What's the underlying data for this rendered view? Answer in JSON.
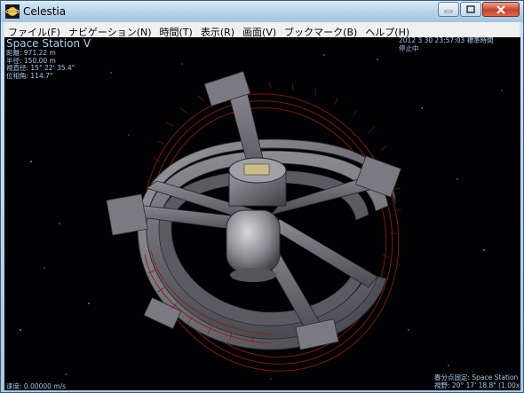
{
  "window": {
    "title": "Celestia"
  },
  "menu": [
    {
      "label": "ファイル(F)"
    },
    {
      "label": "ナビゲーション(N)"
    },
    {
      "label": "時間(T)"
    },
    {
      "label": "表示(R)"
    },
    {
      "label": "画面(V)"
    },
    {
      "label": "ブックマーク(B)"
    },
    {
      "label": "ヘルプ(H)"
    }
  ],
  "info": {
    "object_name": "Space Station V",
    "distance": "距離: 971.22 m",
    "radius": "半径: 150.00 m",
    "apparent_diameter": "視直径: 15° 22' 35.4\"",
    "phase_angle": "位相角: 114.7°"
  },
  "time": {
    "datetime": "2012 3 30 23:57:03 標準時間",
    "status": "停止中"
  },
  "speed": "速度: 0.00000 m/s",
  "camera": {
    "mode": "春分点固定: Space Station",
    "fov": "視野: 20° 17' 18.8\" (1.00x)"
  },
  "colors": {
    "hud_text": "#a9c6ea",
    "background": "#020204",
    "ring_grid": "#8a1a14"
  }
}
